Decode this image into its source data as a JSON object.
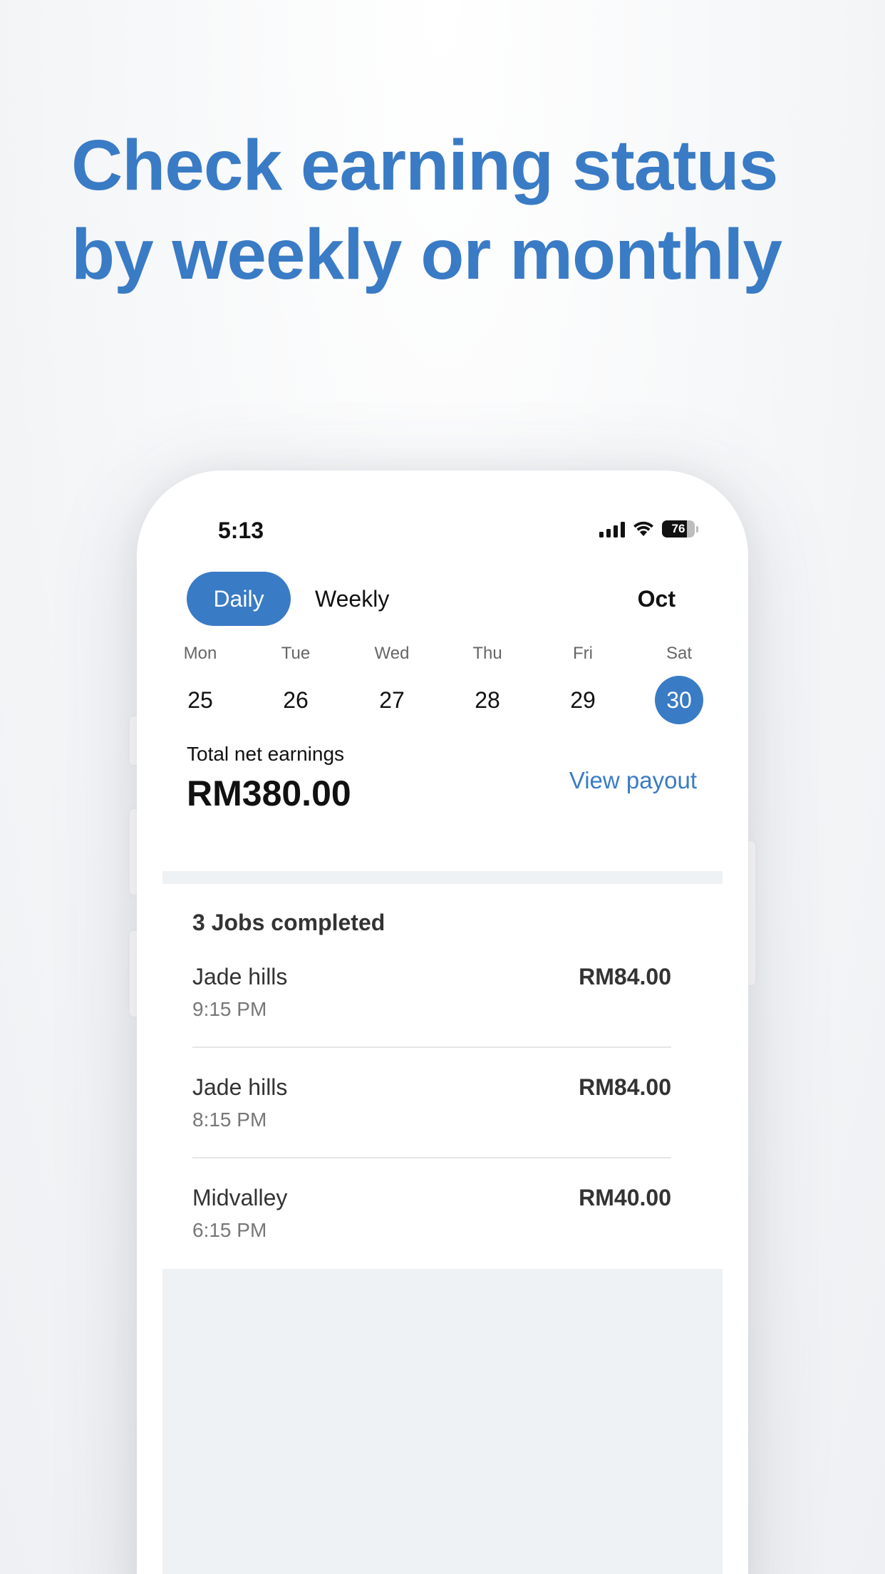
{
  "headline": {
    "line1": "Check earning status",
    "line2": "by weekly or monthly",
    "color": "#3a7bc5"
  },
  "status_bar": {
    "time": "5:13",
    "battery_level": "76"
  },
  "toggle": {
    "daily_label": "Daily",
    "weekly_label": "Weekly",
    "selected": "Daily",
    "month": "Oct"
  },
  "days": [
    {
      "name": "Mon",
      "num": "25"
    },
    {
      "name": "Tue",
      "num": "26"
    },
    {
      "name": "Wed",
      "num": "27"
    },
    {
      "name": "Thu",
      "num": "28"
    },
    {
      "name": "Fri",
      "num": "29"
    },
    {
      "name": "Sat",
      "num": "30",
      "selected": true
    }
  ],
  "earnings": {
    "label": "Total net earnings",
    "amount": "RM380.00",
    "view_payout": "View payout"
  },
  "jobs": {
    "title": "3 Jobs completed",
    "items": [
      {
        "place": "Jade hills",
        "time": "9:15 PM",
        "amount": "RM84.00"
      },
      {
        "place": "Jade hills",
        "time": "8:15 PM",
        "amount": "RM84.00"
      },
      {
        "place": "Midvalley",
        "time": "6:15 PM",
        "amount": "RM40.00"
      }
    ]
  },
  "colors": {
    "accent": "#3a7bc5",
    "panel_bg": "#eef2f5"
  }
}
